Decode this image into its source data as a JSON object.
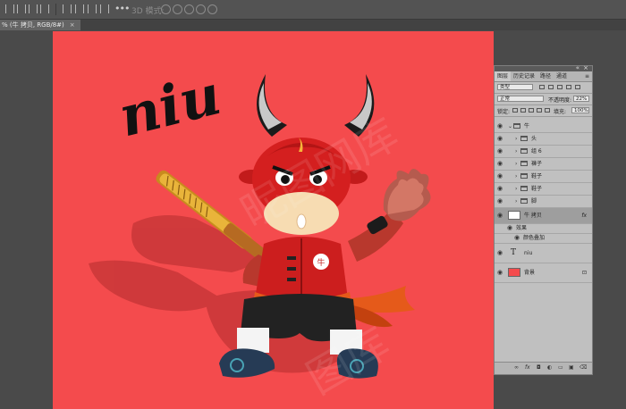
{
  "colors": {
    "artboard": "#f44b4d",
    "workspace": "#4a4a4a",
    "panel_bg": "#c0c0c0"
  },
  "options_bar": {
    "mode_3d_label": "3D 模式:",
    "icons": [
      "align-left-icon",
      "align-center-icon",
      "align-right-icon",
      "align-top-icon",
      "align-middle-icon",
      "align-bottom-icon",
      "distribute-icon",
      "more-icon"
    ]
  },
  "document": {
    "tab_title": "% (牛 拷贝, RGB/8#)",
    "close_glyph": "×"
  },
  "artwork": {
    "headline": "niu",
    "badge_char": "牛"
  },
  "layers_panel": {
    "tabs": [
      "图层",
      "历史记录",
      "路径",
      "通道"
    ],
    "filter_label": "类型",
    "blend_mode": "正常",
    "opacity_label": "不透明度:",
    "opacity_value": "22%",
    "lock_label": "锁定:",
    "fill_label": "填充:",
    "fill_value": "100%",
    "layers": [
      {
        "name": "牛",
        "kind": "group",
        "open": true
      },
      {
        "name": "头",
        "kind": "group"
      },
      {
        "name": "组 6",
        "kind": "group"
      },
      {
        "name": "褲子",
        "kind": "group"
      },
      {
        "name": "鞋子",
        "kind": "group"
      },
      {
        "name": "鞋子",
        "kind": "group"
      },
      {
        "name": "脚",
        "kind": "group"
      },
      {
        "name": "牛 拷贝",
        "kind": "smart",
        "selected": true,
        "fx": "fx"
      },
      {
        "name": "效果",
        "kind": "effect"
      },
      {
        "name": "颜色叠加",
        "kind": "effect-item"
      },
      {
        "name": "niu",
        "kind": "text"
      },
      {
        "name": "背景",
        "kind": "background",
        "locked": true
      }
    ],
    "footer_icons": [
      "link-icon",
      "fx-icon",
      "mask-icon",
      "adjustment-icon",
      "folder-icon",
      "new-layer-icon",
      "trash-icon"
    ]
  }
}
